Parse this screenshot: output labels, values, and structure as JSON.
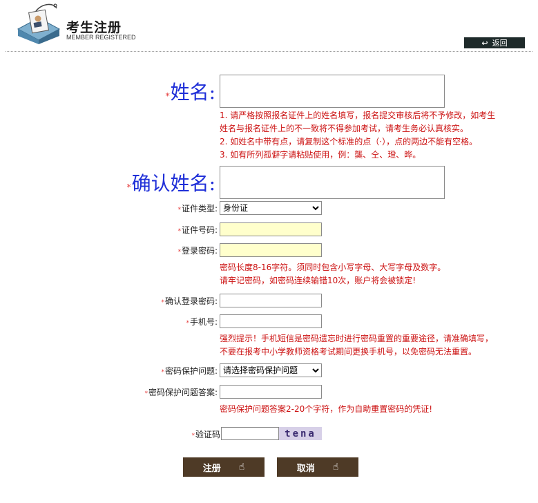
{
  "header": {
    "title_cn": "考生注册",
    "title_en": "MEMBER REGISTERED",
    "back_label": "返回",
    "back_icon": "arrow-left-icon"
  },
  "form": {
    "name_label": "姓名:",
    "name_notes": [
      "1. 请严格按照报名证件上的姓名填写，报名提交审核后将不予修改，如考生",
      "姓名与报名证件上的不一致将不得参加考试，请考生务必认真核实。",
      "2. 如姓名中带有点，请复制这个标准的点（·），点的两边不能有空格。",
      "3. 如有所列孤僻字请粘贴使用，例：龑、仝、璒、晔。"
    ],
    "confirm_name_label": "确认姓名:",
    "id_type_label": "证件类型:",
    "id_type_selected": "身份证",
    "id_number_label": "证件号码:",
    "password_label": "登录密码:",
    "password_notes": [
      "密码长度8-16字符。须同时包含小写字母、大写字母及数字。",
      "请牢记密码，如密码连续输错10次，账户将会被锁定!"
    ],
    "confirm_password_label": "确认登录密码:",
    "phone_label": "手机号:",
    "phone_notes": [
      "强烈提示！手机短信是密码遗忘时进行密码重置的重要途径，请准确填写，",
      "不要在报考中小学教师资格考试期间更换手机号，以免密码无法重置。"
    ],
    "security_question_label": "密码保护问题:",
    "security_question_selected": "请选择密码保护问题",
    "security_answer_label": "密码保护问题答案:",
    "security_answer_note": "密码保护问题答案2-20个字符，作为自助重置密码的凭证!",
    "captcha_label": "验证码",
    "captcha_text": "tena"
  },
  "buttons": {
    "register": "注册",
    "cancel": "取消"
  },
  "colors": {
    "required_star": "#e53b3b",
    "hint_red": "#cc1111",
    "big_label_blue": "#1f2fd8",
    "button_brown": "#4e3a26",
    "highlight_input": "#ffffcc"
  }
}
